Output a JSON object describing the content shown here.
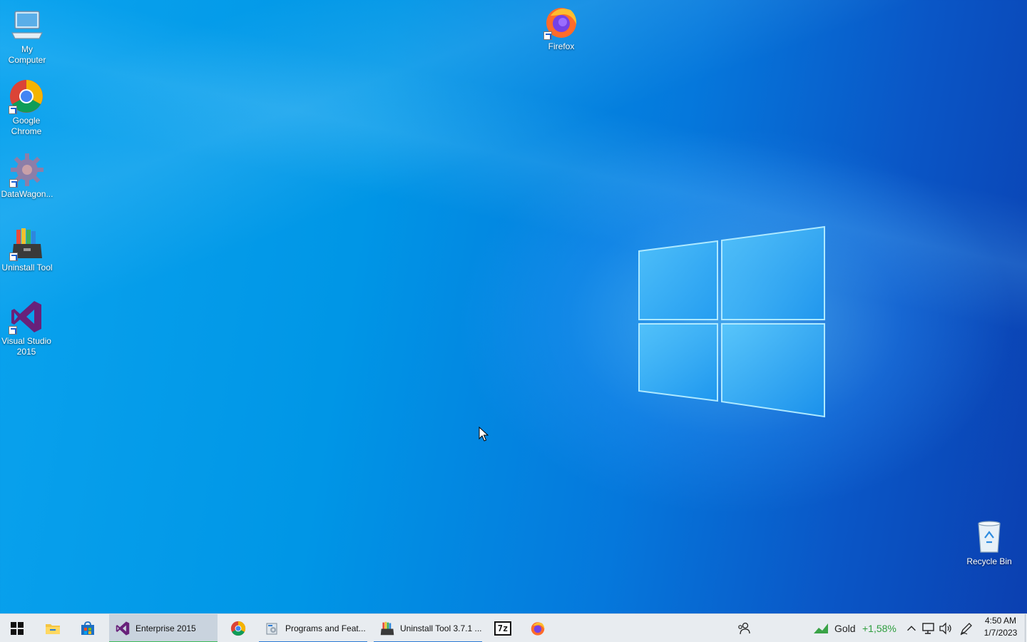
{
  "desktop": {
    "icons": [
      {
        "label": "My\nComputer",
        "icon": "computer-icon"
      },
      {
        "label": "Google\nChrome",
        "icon": "chrome-icon"
      },
      {
        "label": "DataWagon...",
        "icon": "gear-icon"
      },
      {
        "label": "Uninstall Tool",
        "icon": "uninstall-tool-icon"
      },
      {
        "label": "Visual Studio\n2015",
        "icon": "visual-studio-icon"
      },
      {
        "label": "Firefox",
        "icon": "firefox-icon"
      },
      {
        "label": "Recycle Bin",
        "icon": "recycle-bin-icon"
      }
    ]
  },
  "taskbar": {
    "apps": [
      {
        "label": "Enterprise 2015",
        "icon": "visual-studio-icon"
      },
      {
        "label": "",
        "icon": "chrome-icon"
      },
      {
        "label": "Programs and Feat...",
        "icon": "programs-features-icon"
      },
      {
        "label": "Uninstall Tool 3.7.1 ...",
        "icon": "uninstall-tool-icon"
      },
      {
        "label": "",
        "icon": "7zip-icon"
      },
      {
        "label": "",
        "icon": "firefox-icon"
      }
    ],
    "pinned": [
      "start-icon",
      "file-explorer-icon",
      "store-icon"
    ],
    "seven_zip_glyph": "7z",
    "tray": {
      "stock_name": "Gold",
      "stock_change": "+1,58%",
      "stock_change_color": "#2e9e3e",
      "time": "4:50 AM",
      "date": "1/7/2023"
    }
  },
  "colors": {
    "taskbar_bg": "#e8ecf0",
    "active_underline": "#2b7bd6",
    "desktop_accent": "#0a8fe6"
  }
}
